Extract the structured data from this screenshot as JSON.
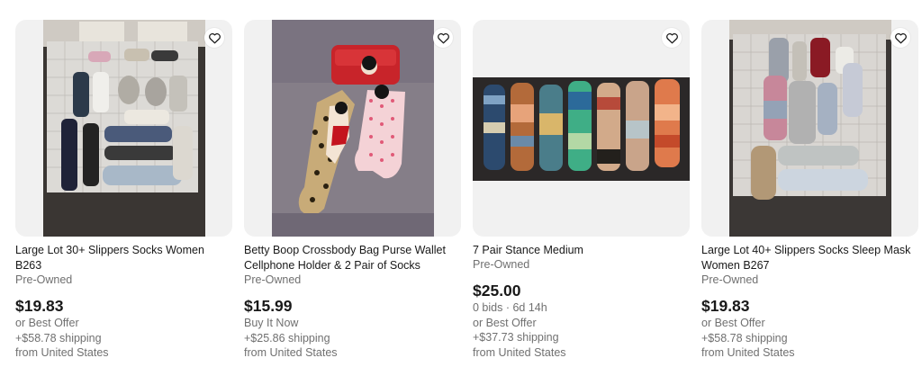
{
  "listings": [
    {
      "title": "Large Lot 30+ Slippers Socks Women B263",
      "condition": "Pre-Owned",
      "price": "$19.83",
      "buying_format": "or Best Offer",
      "shipping": "+$58.78 shipping",
      "location": "from United States",
      "image": "photo of socks and slippers laid on a cutting mat"
    },
    {
      "title": "Betty Boop Crossbody Bag Purse Wallet Cellphone Holder & 2 Pair of Socks",
      "condition": "Pre-Owned",
      "price": "$15.99",
      "buying_format": "Buy It Now",
      "shipping": "+$25.86 shipping",
      "location": "from United States",
      "image": "photo of red Betty Boop wallet and two socks"
    },
    {
      "title": "7 Pair Stance Medium",
      "condition": "Pre-Owned",
      "price": "$25.00",
      "bids": "0 bids · 6d 14h",
      "buying_format": "or Best Offer",
      "shipping": "+$37.73 shipping",
      "location": "from United States",
      "image": "photo of seven pairs of patterned socks"
    },
    {
      "title": "Large Lot 40+ Slippers Socks Sleep Mask Women B267",
      "condition": "Pre-Owned",
      "price": "$19.83",
      "buying_format": "or Best Offer",
      "shipping": "+$58.78 shipping",
      "location": "from United States",
      "image": "photo of socks, slippers and sleep mask on a cutting mat"
    }
  ],
  "icons": {
    "favorite": "heart-outline-icon"
  },
  "colors": {
    "price": "#191919",
    "secondary_text": "#707070",
    "thumb_bg": "#f1f1f1"
  }
}
